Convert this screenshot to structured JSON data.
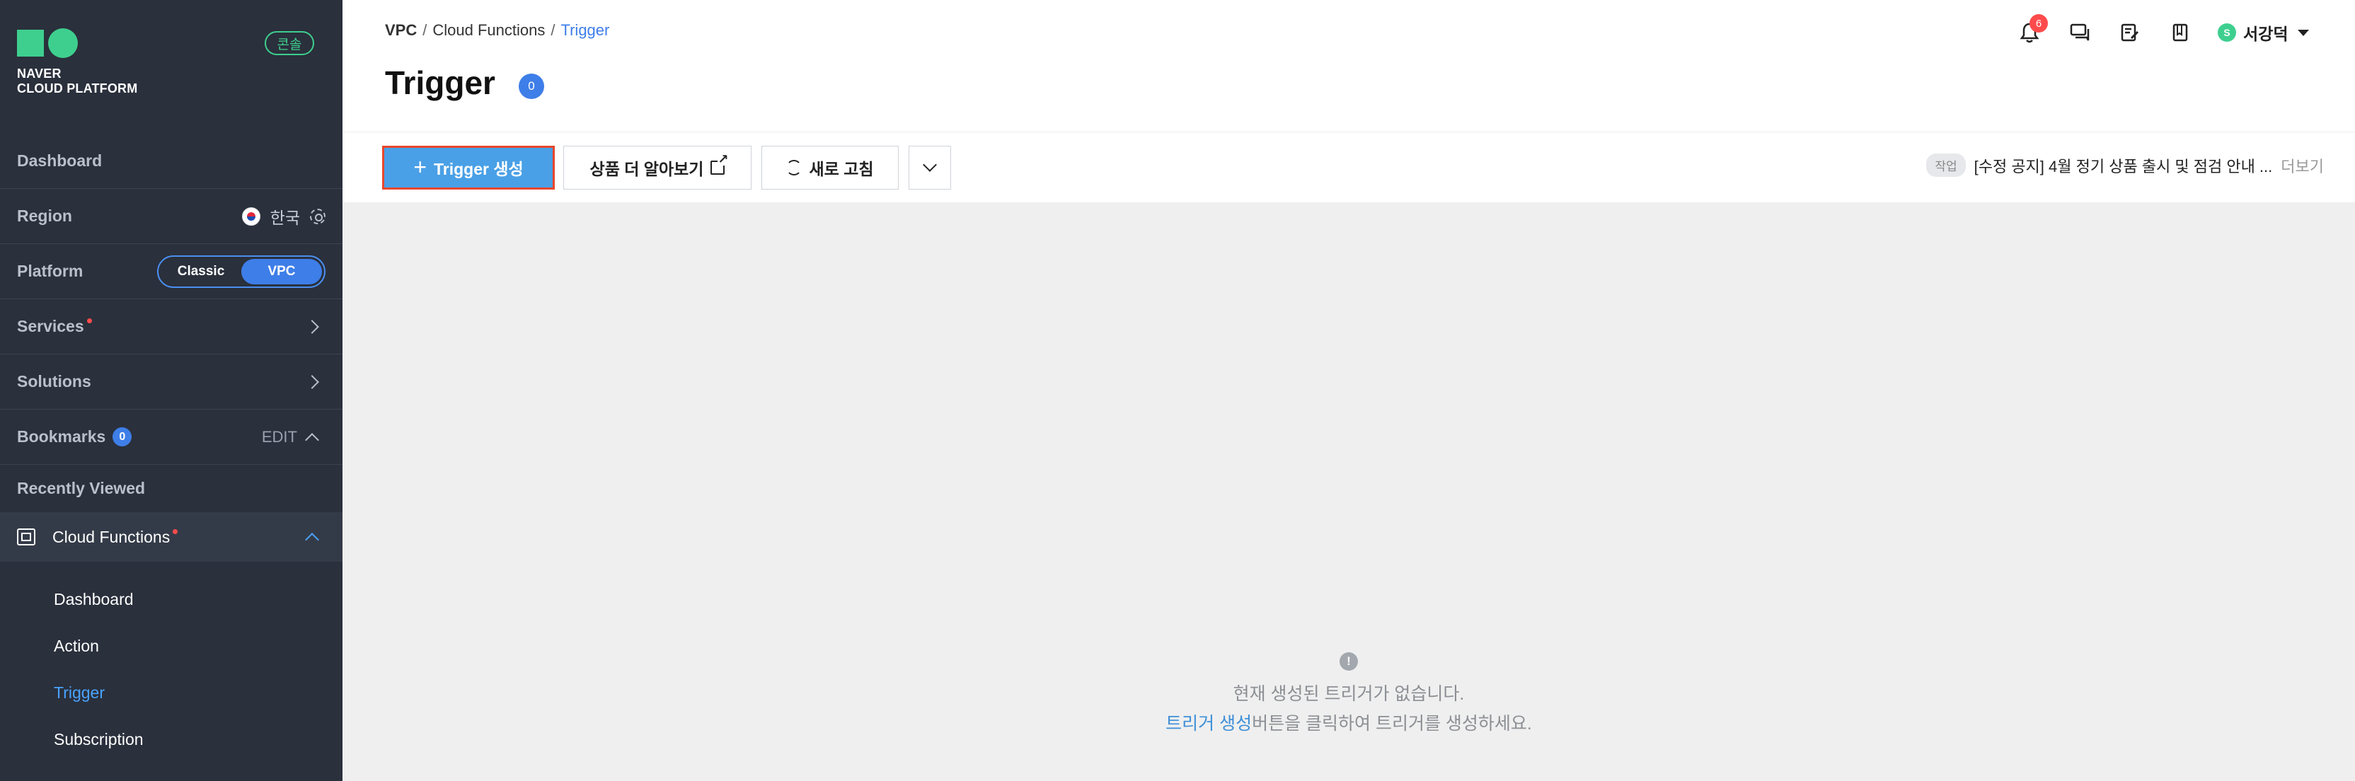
{
  "sidebar": {
    "logo_line1": "NAVER",
    "logo_line2": "CLOUD PLATFORM",
    "console_badge": "콘솔",
    "dashboard": "Dashboard",
    "region_label": "Region",
    "region_value": "한국",
    "platform_label": "Platform",
    "platform_options": [
      "Classic",
      "VPC"
    ],
    "platform_selected": "VPC",
    "services": "Services",
    "solutions": "Solutions",
    "bookmarks": "Bookmarks",
    "bookmarks_count": "0",
    "bookmarks_edit": "EDIT",
    "recently_viewed": "Recently Viewed",
    "cloud_functions": "Cloud Functions",
    "sub_items": [
      "Dashboard",
      "Action",
      "Trigger",
      "Subscription"
    ],
    "active_sub_item": "Trigger"
  },
  "header": {
    "breadcrumb": [
      "VPC",
      "Cloud Functions",
      "Trigger"
    ],
    "breadcrumb_sep": "/",
    "title": "Trigger",
    "title_count": "0",
    "notifications_count": "6",
    "user_initial": "S",
    "user_name": "서강덕"
  },
  "toolbar": {
    "create_label": "Trigger 생성",
    "learn_more_label": "상품 더 알아보기",
    "refresh_label": "새로 고침",
    "notice_tag": "작업",
    "notice_text": "[수정 공지] 4월 정기 상품 출시 및 점검 안내 ...",
    "notice_more": "더보기"
  },
  "empty_state": {
    "icon": "!",
    "line1": "현재 생성된 트리거가 없습니다.",
    "line2_link": "트리거 생성",
    "line2_rest": "버튼을 클릭하여 트리거를 생성하세요."
  },
  "colors": {
    "sidebar_bg": "#2a303c",
    "brand_green": "#3ecf8e",
    "accent_blue": "#3e7ee8",
    "primary_button": "#4aa0e6",
    "highlight_border": "#e8472c",
    "content_bg": "#efefef"
  }
}
